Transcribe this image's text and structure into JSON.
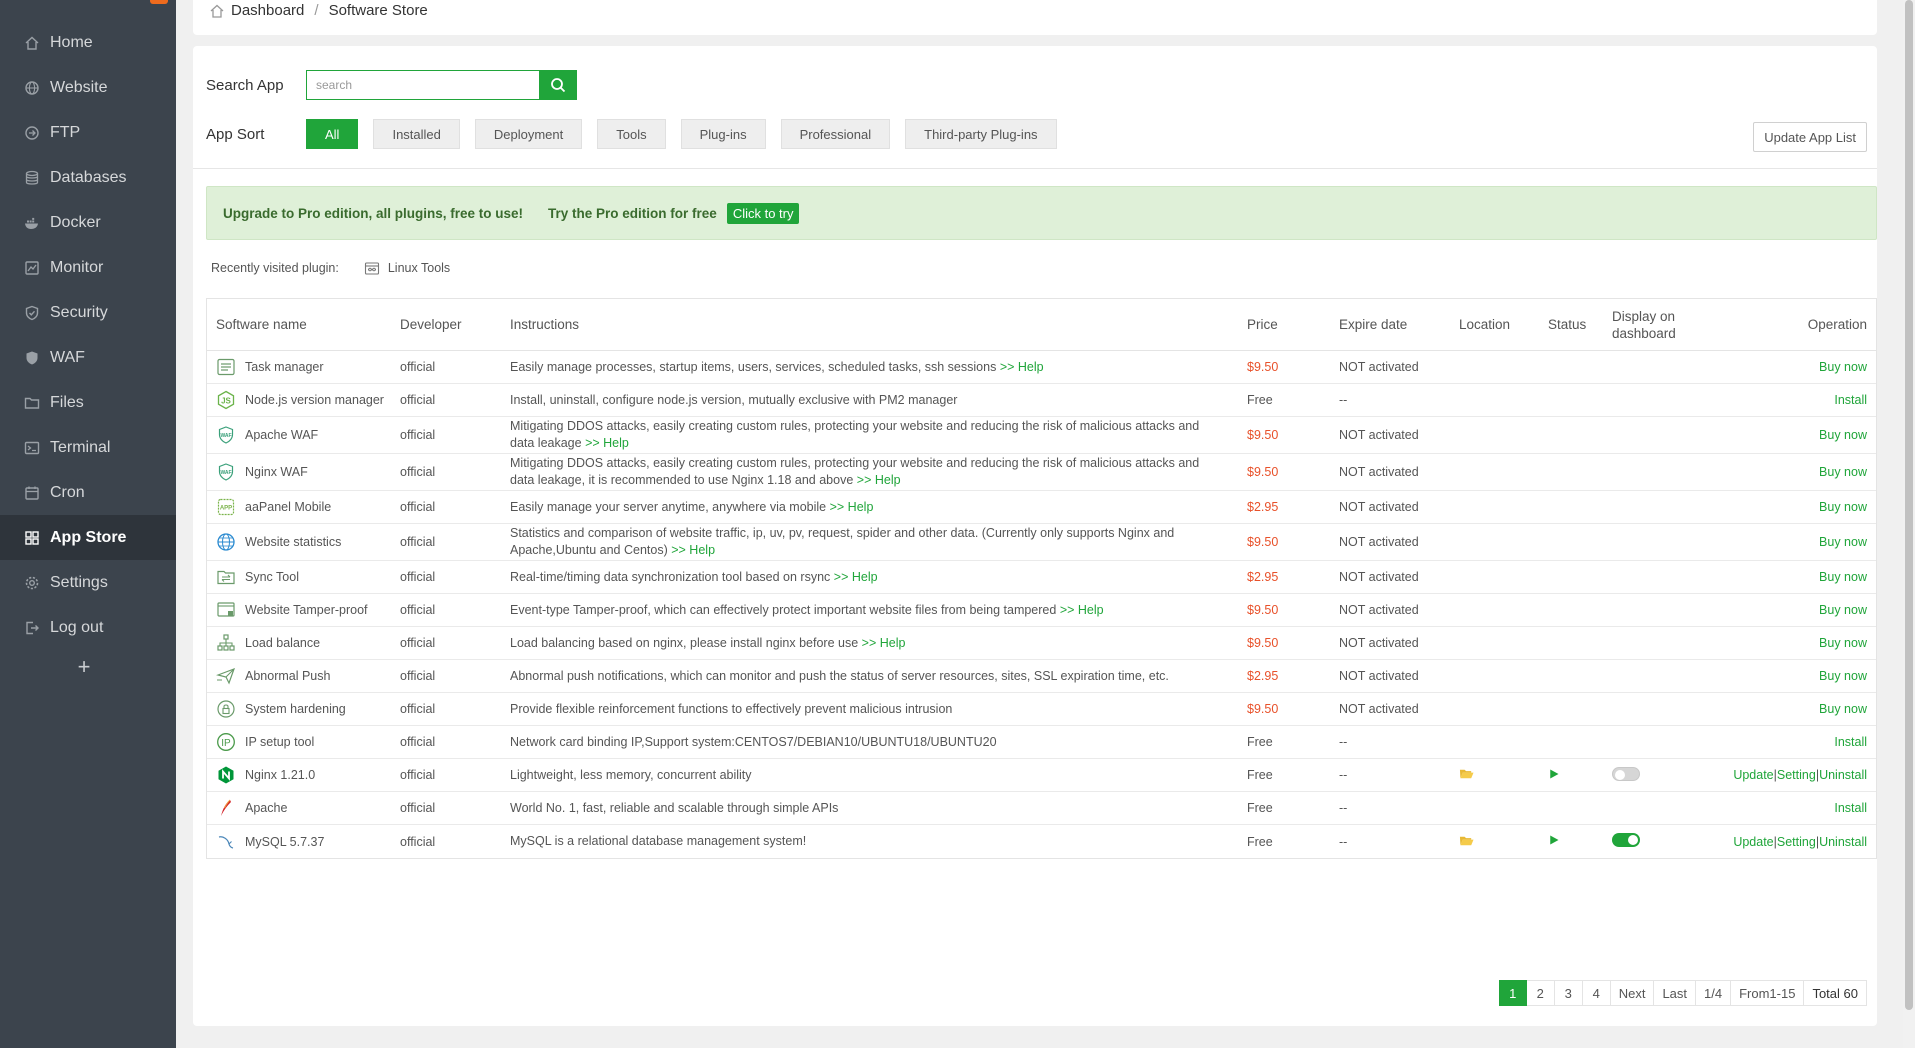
{
  "sidebar": {
    "items": [
      {
        "label": "Home",
        "icon": "home-icon"
      },
      {
        "label": "Website",
        "icon": "globe-icon"
      },
      {
        "label": "FTP",
        "icon": "ftp-icon"
      },
      {
        "label": "Databases",
        "icon": "database-icon"
      },
      {
        "label": "Docker",
        "icon": "docker-icon"
      },
      {
        "label": "Monitor",
        "icon": "monitor-icon"
      },
      {
        "label": "Security",
        "icon": "shield-check-icon"
      },
      {
        "label": "WAF",
        "icon": "shield-icon"
      },
      {
        "label": "Files",
        "icon": "folder-icon"
      },
      {
        "label": "Terminal",
        "icon": "terminal-icon"
      },
      {
        "label": "Cron",
        "icon": "calendar-icon"
      },
      {
        "label": "App Store",
        "icon": "apps-grid-icon"
      },
      {
        "label": "Settings",
        "icon": "gear-icon"
      },
      {
        "label": "Log out",
        "icon": "logout-icon"
      }
    ],
    "active_index": 11,
    "add_label": "+"
  },
  "breadcrumb": {
    "home": "Dashboard",
    "separator": "/",
    "current": "Software Store"
  },
  "search": {
    "label": "Search App",
    "placeholder": "search"
  },
  "sort": {
    "label": "App Sort",
    "options": [
      "All",
      "Installed",
      "Deployment",
      "Tools",
      "Plug-ins",
      "Professional",
      "Third-party Plug-ins"
    ],
    "active": "All"
  },
  "update_button": "Update App List",
  "promo": {
    "text": "Upgrade to Pro edition, all plugins, free to use!",
    "try_text": "Try the Pro edition for free",
    "button": "Click to try"
  },
  "recent": {
    "label": "Recently visited plugin:",
    "plugin": "Linux Tools"
  },
  "table": {
    "headers": {
      "name": "Software name",
      "developer": "Developer",
      "instructions": "Instructions",
      "price": "Price",
      "expire": "Expire date",
      "location": "Location",
      "status": "Status",
      "display": "Display on dashboard",
      "operation": "Operation"
    },
    "rows": [
      {
        "name": "Task manager",
        "icon": "task-manager-icon",
        "developer": "official",
        "instructions": "Easily manage processes, startup items, users, services, scheduled tasks, ssh sessions",
        "help": ">> Help",
        "price": "$9.50",
        "paid": true,
        "expire": "NOT activated",
        "op": [
          "Buy now"
        ]
      },
      {
        "name": "Node.js version manager",
        "icon": "nodejs-icon",
        "developer": "official",
        "instructions": "Install, uninstall, configure node.js version, mutually exclusive with PM2 manager",
        "help": "",
        "price": "Free",
        "paid": false,
        "expire": "--",
        "op": [
          "Install"
        ]
      },
      {
        "name": "Apache WAF",
        "icon": "apache-waf-icon",
        "developer": "official",
        "instructions": "Mitigating DDOS attacks, easily creating custom rules, protecting your website and reducing the risk of malicious attacks and data leakage",
        "help": ">> Help",
        "price": "$9.50",
        "paid": true,
        "expire": "NOT activated",
        "op": [
          "Buy now"
        ]
      },
      {
        "name": "Nginx WAF",
        "icon": "nginx-waf-icon",
        "developer": "official",
        "instructions": "Mitigating DDOS attacks, easily creating custom rules, protecting your website and reducing the risk of malicious attacks and data leakage, it is recommended to use Nginx 1.18 and above",
        "help": ">> Help",
        "price": "$9.50",
        "paid": true,
        "expire": "NOT activated",
        "op": [
          "Buy now"
        ]
      },
      {
        "name": "aaPanel Mobile",
        "icon": "app-mobile-icon",
        "developer": "official",
        "instructions": "Easily manage your server anytime, anywhere via mobile",
        "help": ">> Help",
        "price": "$2.95",
        "paid": true,
        "expire": "NOT activated",
        "op": [
          "Buy now"
        ]
      },
      {
        "name": "Website statistics",
        "icon": "globe-stats-icon",
        "developer": "official",
        "instructions": "Statistics and comparison of website traffic, ip, uv, pv, request, spider and other data. (Currently only supports Nginx and Apache,Ubuntu and Centos)",
        "help": ">> Help",
        "price": "$9.50",
        "paid": true,
        "expire": "NOT activated",
        "op": [
          "Buy now"
        ]
      },
      {
        "name": "Sync Tool",
        "icon": "sync-folder-icon",
        "developer": "official",
        "instructions": "Real-time/timing data synchronization tool based on rsync",
        "help": ">> Help",
        "price": "$2.95",
        "paid": true,
        "expire": "NOT activated",
        "op": [
          "Buy now"
        ]
      },
      {
        "name": "Website Tamper-proof",
        "icon": "tamper-proof-icon",
        "developer": "official",
        "instructions": "Event-type Tamper-proof, which can effectively protect important website files from being tampered",
        "help": ">> Help",
        "price": "$9.50",
        "paid": true,
        "expire": "NOT activated",
        "op": [
          "Buy now"
        ]
      },
      {
        "name": "Load balance",
        "icon": "load-balance-icon",
        "developer": "official",
        "instructions": "Load balancing based on nginx, please install nginx before use",
        "help": ">> Help",
        "price": "$9.50",
        "paid": true,
        "expire": "NOT activated",
        "op": [
          "Buy now"
        ]
      },
      {
        "name": "Abnormal Push",
        "icon": "push-icon",
        "developer": "official",
        "instructions": "Abnormal push notifications, which can monitor and push the status of server resources, sites, SSL expiration time, etc.",
        "help": "",
        "price": "$2.95",
        "paid": true,
        "expire": "NOT activated",
        "op": [
          "Buy now"
        ]
      },
      {
        "name": "System hardening",
        "icon": "lock-shield-icon",
        "developer": "official",
        "instructions": "Provide flexible reinforcement functions to effectively prevent malicious intrusion",
        "help": "",
        "price": "$9.50",
        "paid": true,
        "expire": "NOT activated",
        "op": [
          "Buy now"
        ]
      },
      {
        "name": "IP setup tool",
        "icon": "ip-icon",
        "developer": "official",
        "instructions": "Network card binding IP,Support system:CENTOS7/DEBIAN10/UBUNTU18/UBUNTU20",
        "help": "",
        "price": "Free",
        "paid": false,
        "expire": "--",
        "op": [
          "Install"
        ]
      },
      {
        "name": "Nginx 1.21.0",
        "icon": "nginx-icon",
        "developer": "official",
        "instructions": "Lightweight, less memory, concurrent ability",
        "help": "",
        "price": "Free",
        "paid": false,
        "expire": "--",
        "installed": true,
        "display_on": false,
        "op": [
          "Update",
          "Setting",
          "Uninstall"
        ]
      },
      {
        "name": "Apache",
        "icon": "apache-feather-icon",
        "developer": "official",
        "instructions": "World No. 1, fast, reliable and scalable through simple APIs",
        "help": "",
        "price": "Free",
        "paid": false,
        "expire": "--",
        "op": [
          "Install"
        ]
      },
      {
        "name": "MySQL 5.7.37",
        "icon": "mysql-icon",
        "developer": "official",
        "instructions": "MySQL is a relational database management system!",
        "help": "",
        "price": "Free",
        "paid": false,
        "expire": "--",
        "installed": true,
        "display_on": true,
        "op": [
          "Update",
          "Setting",
          "Uninstall"
        ]
      }
    ]
  },
  "pagination": {
    "pages": [
      "1",
      "2",
      "3",
      "4"
    ],
    "active": "1",
    "next": "Next",
    "last": "Last",
    "page_of": "1/4",
    "range": "From1-15",
    "total": "Total 60"
  },
  "colors": {
    "accent": "#20a53a",
    "price_paid": "#e8512a",
    "sidebar_bg": "#3c444d",
    "sidebar_active_bg": "#2e343b",
    "promo_bg": "#dff0d8"
  }
}
